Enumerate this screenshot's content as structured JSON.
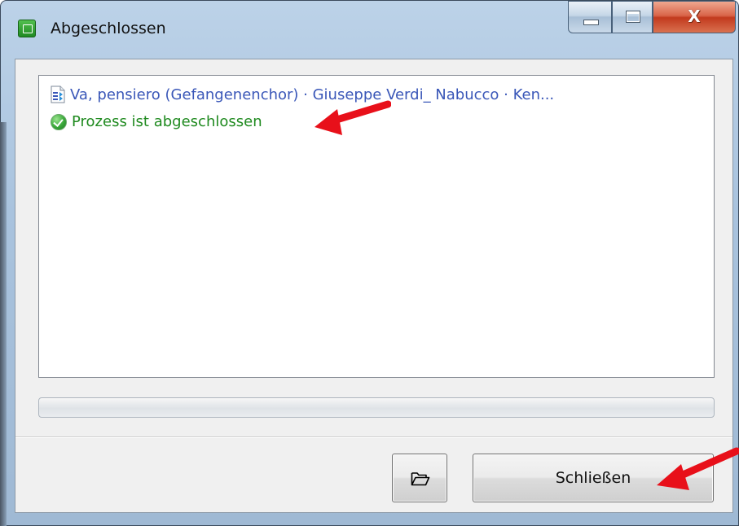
{
  "window": {
    "title": "Abgeschlossen",
    "caption": {
      "close_glyph": "X"
    }
  },
  "list": {
    "items": [
      {
        "icon": "audio-file-icon",
        "text": "Va, pensiero (Gefangenenchor) · Giuseppe Verdi_ Nabucco · Ken...",
        "color": "#3a57b8"
      },
      {
        "icon": "success-check-icon",
        "text": "Prozess ist abgeschlossen",
        "color": "#1f8a1f"
      }
    ]
  },
  "progress": {
    "value": 0
  },
  "buttons": {
    "open_folder_icon": "folder-open-icon",
    "close_label": "Schließen"
  },
  "annotations": {
    "arrow_color": "#e8101a"
  }
}
